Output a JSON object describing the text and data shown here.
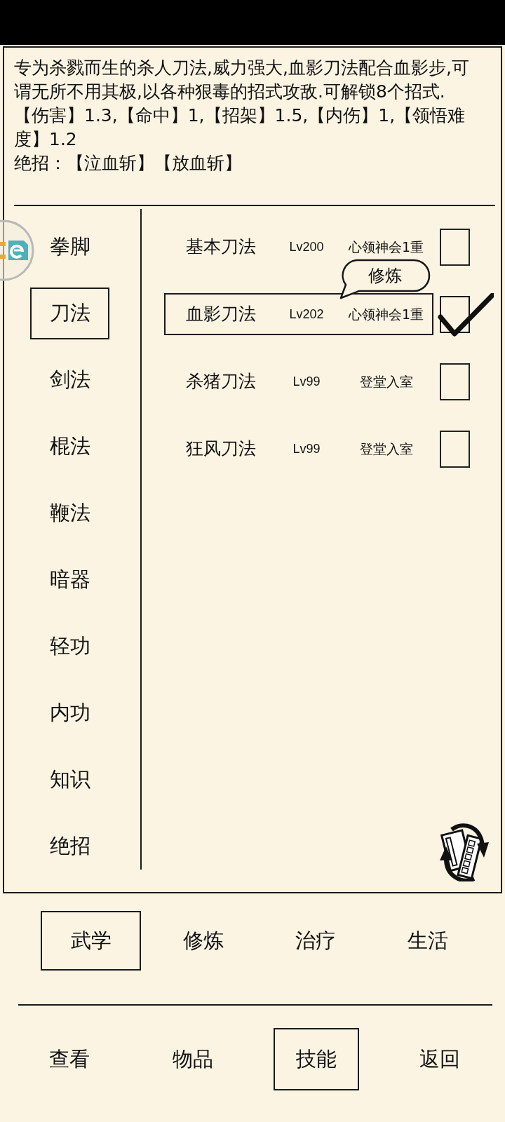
{
  "description": {
    "summary": "专为杀戮而生的杀人刀法,威力强大,血影刀法配合血影步,可谓无所不用其极,以各种狠毒的招式攻敌.可解锁8个招式.",
    "stats": "【伤害】1.3,【命中】1,【招架】1.5,【内伤】1,【领悟难度】1.2",
    "ultimate": "绝招：【泣血斩】【放血斩】"
  },
  "categories": [
    {
      "label": "拳脚",
      "selected": false
    },
    {
      "label": "刀法",
      "selected": true
    },
    {
      "label": "剑法",
      "selected": false
    },
    {
      "label": "棍法",
      "selected": false
    },
    {
      "label": "鞭法",
      "selected": false
    },
    {
      "label": "暗器",
      "selected": false
    },
    {
      "label": "轻功",
      "selected": false
    },
    {
      "label": "内功",
      "selected": false
    },
    {
      "label": "知识",
      "selected": false
    },
    {
      "label": "绝招",
      "selected": false
    }
  ],
  "skills": {
    "popup_button": "修炼",
    "rows": [
      {
        "name": "基本刀法",
        "lv": "Lv200",
        "rank": "心领神会1重",
        "selected": false,
        "checked": false
      },
      {
        "name": "血影刀法",
        "lv": "Lv202",
        "rank": "心领神会1重",
        "selected": true,
        "checked": true
      },
      {
        "name": "杀猪刀法",
        "lv": "Lv99",
        "rank": "登堂入室",
        "selected": false,
        "checked": false
      },
      {
        "name": "狂风刀法",
        "lv": "Lv99",
        "rank": "登堂入室",
        "selected": false,
        "checked": false
      }
    ]
  },
  "tabs": [
    {
      "label": "武学",
      "selected": true
    },
    {
      "label": "修炼",
      "selected": false
    },
    {
      "label": "治疗",
      "selected": false
    },
    {
      "label": "生活",
      "selected": false
    }
  ],
  "nav": [
    {
      "label": "查看",
      "selected": false
    },
    {
      "label": "物品",
      "selected": false
    },
    {
      "label": "技能",
      "selected": true
    },
    {
      "label": "返回",
      "selected": false
    }
  ]
}
